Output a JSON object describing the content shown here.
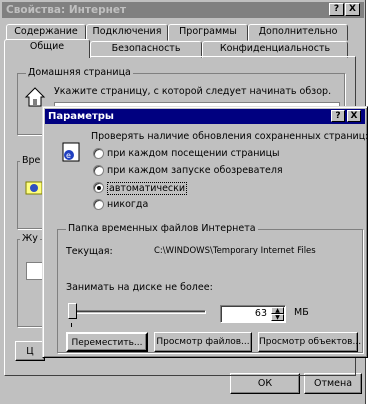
{
  "outer": {
    "title": "Свойства: Интернет",
    "title_buttons": {
      "help": "?",
      "close": "X"
    },
    "tabs_back": [
      "Содержание",
      "Подключения",
      "Программы",
      "Дополнительно"
    ],
    "tabs_front": [
      "Общие",
      "Безопасность",
      "Конфиденциальность"
    ],
    "home_group_label": "Домашняя страница",
    "home_text": "Укажите страницу, с которой следует начинать обзор.",
    "group2_label": "Вре",
    "group3_label": "Жу",
    "bottom_stub_label": "Ц",
    "ok_label": "ОК",
    "cancel_label": "Отмена"
  },
  "dialog": {
    "title": "Параметры",
    "title_buttons": {
      "help": "?",
      "close": "X"
    },
    "check_label": "Проверять наличие обновления сохраненных страниц:",
    "options": [
      {
        "label": "при каждом посещении страницы",
        "selected": false
      },
      {
        "label": "при каждом запуске обозревателя",
        "selected": false
      },
      {
        "label": "автоматически",
        "selected": true
      },
      {
        "label": "никогда",
        "selected": false
      }
    ],
    "temp_group_label": "Папка временных файлов Интернета",
    "current_label": "Текущая:",
    "current_path": "C:\\WINDOWS\\Temporary Internet Files",
    "disk_label": "Занимать на диске не более:",
    "disk_value": "63",
    "disk_unit": "МБ",
    "slider_fraction": 0.0,
    "move_button": "Переместить...",
    "view_files_button": "Просмотр файлов...",
    "view_objects_button": "Просмотр объектов..."
  }
}
